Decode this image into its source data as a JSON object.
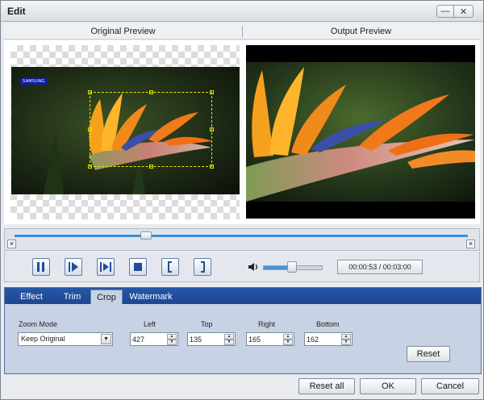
{
  "window": {
    "title": "Edit",
    "minimize_glyph": "—",
    "close_glyph": "✕"
  },
  "preview": {
    "original_label": "Original Preview",
    "output_label": "Output Preview"
  },
  "watermark_text": "SAMSUNG",
  "timeline": {
    "position_fraction": 0.29
  },
  "player": {
    "buttons": [
      "pause-icon",
      "play-next-frame-icon",
      "play-selection-icon",
      "stop-icon",
      "mark-start-icon",
      "mark-end-icon"
    ],
    "volume_fraction": 0.5,
    "time_display": "00:00:53 / 00:03:00"
  },
  "tabs": [
    "Effect",
    "Trim",
    "Crop",
    "Watermark"
  ],
  "active_tab": "Crop",
  "crop": {
    "zoom_mode_label": "Zoom Mode",
    "zoom_mode_value": "Keep Original",
    "left_label": "Left",
    "left_value": "427",
    "top_label": "Top",
    "top_value": "135",
    "right_label": "Right",
    "right_value": "165",
    "bottom_label": "Bottom",
    "bottom_value": "162",
    "reset_label": "Reset"
  },
  "footer": {
    "reset_all_label": "Reset all",
    "ok_label": "OK",
    "cancel_label": "Cancel"
  },
  "colors": {
    "tab_bar": "#2657a8",
    "crop_frame": "#e6e600",
    "timeline_track": "#3c8fd9",
    "panel": "#c7d3e4"
  }
}
